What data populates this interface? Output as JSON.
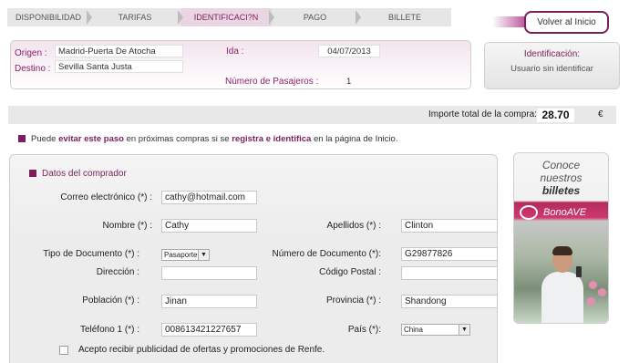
{
  "steps": [
    {
      "label": "DISPONIBILIDAD"
    },
    {
      "label": "TARIFAS"
    },
    {
      "label": "IDENTIFICACI?N"
    },
    {
      "label": "PAGO"
    },
    {
      "label": "BILLETE"
    }
  ],
  "header": {
    "volver_label": "Volver al Inicio"
  },
  "trip": {
    "origen_label": "Origen :",
    "origen_value": "Madrid-Puerta De Atocha",
    "destino_label": "Destino :",
    "destino_value": "Sevilla Santa Justa",
    "ida_label": "Ida :",
    "ida_value": "04/07/2013",
    "pasajeros_label": "Número de Pasajeros :",
    "pasajeros_value": "1"
  },
  "ident": {
    "title": "Identificación:",
    "status": "Usuario sin identificar"
  },
  "importe": {
    "label": "Importe total de la compra:",
    "amount": "28.70",
    "currency": "€"
  },
  "info": {
    "pre": "Puede ",
    "b1": "evitar este paso",
    "mid1": " en próximas compras si se ",
    "b2": "registra e identifica",
    "mid2": " en la página de Inicio."
  },
  "form": {
    "title": "Datos del comprador",
    "email_label": "Correo electrónico (*) :",
    "email_value": "cathy@hotmail.com",
    "nombre_label": "Nombre (*) :",
    "nombre_value": "Cathy",
    "apellidos_label": "Apellidos (*) :",
    "apellidos_value": "Clinton",
    "tipo_doc_label": "Tipo de Documento (*) :",
    "tipo_doc_value": "Pasaporte",
    "num_doc_label": "Número de Documento (*):",
    "num_doc_value": "G29877826",
    "direccion_label": "Dirección :",
    "direccion_value": "",
    "cp_label": "Código Postal :",
    "cp_value": "",
    "poblacion_label": "Población (*) :",
    "poblacion_value": "Jinan",
    "provincia_label": "Provincia (*) :",
    "provincia_value": "Shandong",
    "telefono_label": "Teléfono 1 (*) :",
    "telefono_value": "008613421227657",
    "pais_label": "País (*):",
    "pais_value": "China",
    "publicidad_label": "Acepto recibir publicidad de ofertas y promociones de Renfe.",
    "publicidad_checked": false
  },
  "banner": {
    "line1": "Conoce",
    "line2": "nuestros",
    "line3": "billetes",
    "bono": "BonoAVE"
  },
  "colors": {
    "brand": "#7a1f5c",
    "accent_gradient": "#b24794"
  }
}
